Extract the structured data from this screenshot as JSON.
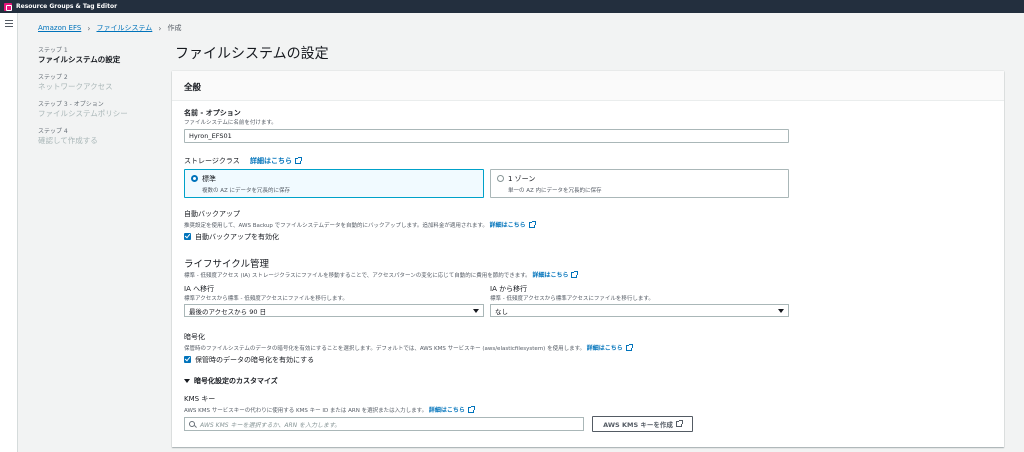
{
  "topbar": {
    "title": "Resource Groups & Tag Editor"
  },
  "breadcrumb": {
    "items": [
      "Amazon EFS",
      "ファイルシステム",
      "作成"
    ]
  },
  "steps": [
    {
      "num": "ステップ 1",
      "label": "ファイルシステムの設定",
      "active": true
    },
    {
      "num": "ステップ 2",
      "label": "ネットワークアクセス",
      "active": false
    },
    {
      "num": "ステップ 3 - オプション",
      "label": "ファイルシステムポリシー",
      "active": false
    },
    {
      "num": "ステップ 4",
      "label": "確認して作成する",
      "active": false
    }
  ],
  "page_title": "ファイルシステムの設定",
  "panel": {
    "header": "全般",
    "name": {
      "label": "名前 - オプション",
      "desc": "ファイルシステムに名前を付けます。",
      "value": "Hyron_EFS01"
    },
    "storage_class": {
      "label": "ストレージクラス",
      "link": "詳細はこちら",
      "options": [
        {
          "label": "標準",
          "desc": "複数の AZ にデータを冗長的に保存",
          "selected": true
        },
        {
          "label": "1 ゾーン",
          "desc": "単一の AZ 内にデータを冗長的に保存",
          "selected": false
        }
      ]
    },
    "backup": {
      "label": "自動バックアップ",
      "desc": "推奨設定を使用して、AWS Backup でファイルシステムデータを自動的にバックアップします。追加料金が適用されます。",
      "link": "詳細はこちら",
      "checkbox": "自動バックアップを有効化"
    },
    "lifecycle": {
      "title": "ライフサイクル管理",
      "desc": "標準 - 低頻度アクセス (IA) ストレージクラスにファイルを移動することで、アクセスパターンの変化に応じて自動的に費用を節約できます。",
      "link": "詳細はこちら",
      "to_ia": {
        "label": "IA へ移行",
        "desc": "標準アクセスから標準 - 低頻度アクセスにファイルを移行します。",
        "value": "最後のアクセスから 90 日"
      },
      "from_ia": {
        "label": "IA から移行",
        "desc": "標準 - 低頻度アクセスから標準アクセスにファイルを移行します。",
        "value": "なし"
      }
    },
    "encryption": {
      "label": "暗号化",
      "desc": "保管時のファイルシステムのデータの暗号化を有効にすることを選択します。デフォルトでは、AWS KMS サービスキー (aws/elasticfilesystem) を使用します。",
      "link": "詳細はこちら",
      "checkbox": "保管時のデータの暗号化を有効にする",
      "customize": "暗号化設定のカスタマイズ"
    },
    "kms": {
      "label": "KMS キー",
      "desc": "AWS KMS サービスキーの代わりに使用する KMS キー ID または ARN を選択または入力します。",
      "link": "詳細はこちら",
      "placeholder": "AWS KMS キーを選択するか、ARN を入力します。",
      "create_button": "AWS KMS キーを作成"
    }
  }
}
